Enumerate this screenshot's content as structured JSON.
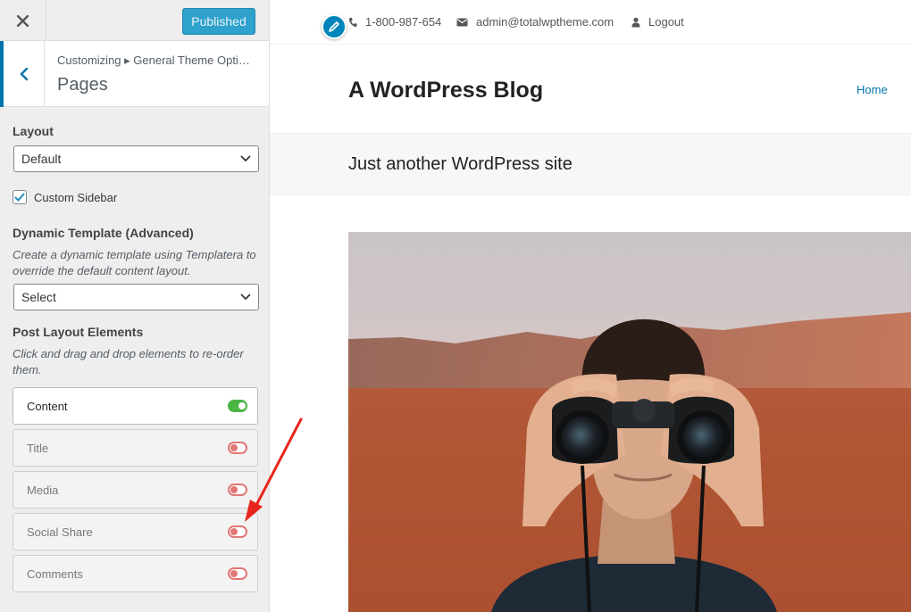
{
  "sidebar": {
    "close_icon": "close-icon",
    "published_label": "Published",
    "breadcrumb": "Customizing ▸ General Theme Opti…",
    "section_title": "Pages",
    "layout": {
      "label": "Layout",
      "value": "Default"
    },
    "custom_sidebar": {
      "label": "Custom Sidebar",
      "checked": true
    },
    "dynamic_template": {
      "label": "Dynamic Template (Advanced)",
      "description": "Create a dynamic template using Templatera to override the default content layout.",
      "value": "Select"
    },
    "post_layout": {
      "label": "Post Layout Elements",
      "description": "Click and drag and drop elements to re-order them.",
      "items": [
        {
          "label": "Content",
          "enabled": true
        },
        {
          "label": "Title",
          "enabled": false
        },
        {
          "label": "Media",
          "enabled": false
        },
        {
          "label": "Social Share",
          "enabled": false
        },
        {
          "label": "Comments",
          "enabled": false
        }
      ]
    }
  },
  "preview": {
    "topbar": {
      "phone": "1-800-987-654",
      "email": "admin@totalwptheme.com",
      "logout": "Logout"
    },
    "site_title": "A WordPress Blog",
    "nav_home": "Home",
    "tagline": "Just another WordPress site",
    "featured_image": "man-with-binoculars-desert-photo"
  },
  "colors": {
    "accent": "#0073aa",
    "published": "#2ea2cc",
    "toggle_on": "#4bb543",
    "toggle_off": "#e17676",
    "annotation_arrow": "#e8261c"
  }
}
